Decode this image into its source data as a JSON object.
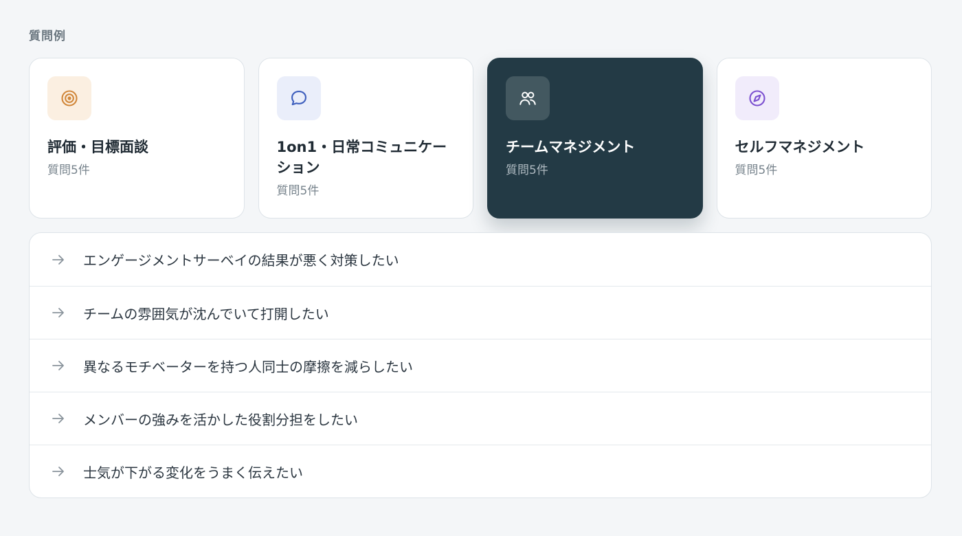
{
  "section": {
    "label": "質問例"
  },
  "categories": [
    {
      "title": "評価・目標面談",
      "count": "質問5件",
      "icon": "target-icon",
      "icon_color": "#d1873a",
      "icon_bg": "#fbefe1",
      "active": false
    },
    {
      "title": "1on1・日常コミュニケーション",
      "count": "質問5件",
      "icon": "chat-bubble-icon",
      "icon_color": "#3d5ebd",
      "icon_bg": "#eaeefa",
      "active": false
    },
    {
      "title": "チームマネジメント",
      "count": "質問5件",
      "icon": "users-icon",
      "icon_color": "#ffffff",
      "icon_bg": "#435860",
      "active": true
    },
    {
      "title": "セルフマネジメント",
      "count": "質問5件",
      "icon": "compass-icon",
      "icon_color": "#7b4fd0",
      "icon_bg": "#f1ecfb",
      "active": false
    }
  ],
  "questions": [
    "エンゲージメントサーベイの結果が悪く対策したい",
    "チームの雰囲気が沈んでいて打開したい",
    "異なるモチベーターを持つ人同士の摩擦を減らしたい",
    "メンバーの強みを活かした役割分担をしたい",
    "士気が下がる変化をうまく伝えたい"
  ],
  "colors": {
    "background": "#f4f6f8",
    "active_card": "#233a45",
    "arrow": "#8a949c"
  }
}
